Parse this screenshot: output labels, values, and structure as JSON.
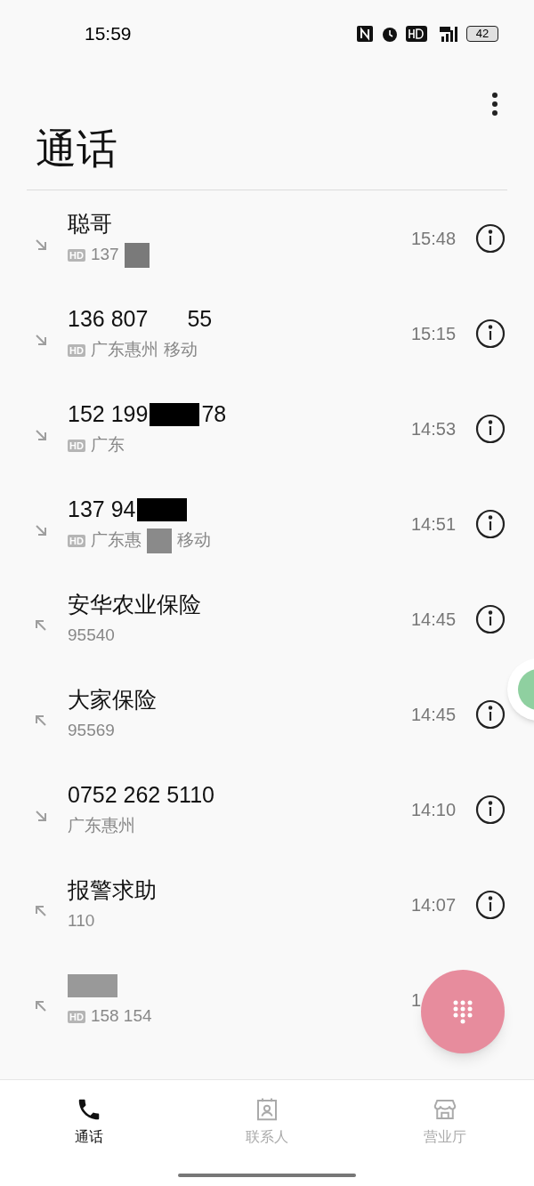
{
  "status_bar": {
    "time": "15:59",
    "battery": "42"
  },
  "header": {
    "title": "通话"
  },
  "calls": [
    {
      "kind": "incoming",
      "hd_badge": "HD",
      "title": [
        {
          "kind": "text",
          "text": "聪哥"
        }
      ],
      "subtitle": [
        {
          "kind": "text",
          "text": "137"
        },
        {
          "kind": "redacted",
          "color": "#7a7a7a"
        }
      ],
      "time": "15:48",
      "info_button": true
    },
    {
      "kind": "incoming",
      "hd_badge": "HD",
      "title": [
        {
          "kind": "text",
          "text": "136 807"
        },
        {
          "kind": "gap"
        },
        {
          "kind": "text",
          "text": "55"
        }
      ],
      "subtitle": [
        {
          "kind": "text",
          "text": "广东惠州"
        },
        {
          "kind": "text",
          "text": "移动"
        }
      ],
      "time": "15:15",
      "info_button": true
    },
    {
      "kind": "incoming",
      "hd_badge": "HD",
      "title": [
        {
          "kind": "text",
          "text": "152 199"
        },
        {
          "kind": "redacted",
          "color": "#000000"
        },
        {
          "kind": "text",
          "text": "78"
        }
      ],
      "subtitle": [
        {
          "kind": "text",
          "text": "广东"
        }
      ],
      "time": "14:53",
      "info_button": true
    },
    {
      "kind": "incoming",
      "hd_badge": "HD",
      "title": [
        {
          "kind": "text",
          "text": "137 94"
        },
        {
          "kind": "redacted",
          "color": "#000000"
        }
      ],
      "subtitle": [
        {
          "kind": "text",
          "text": "广东惠"
        },
        {
          "kind": "redacted",
          "color": "#8a8a8a"
        },
        {
          "kind": "text",
          "text": "移动"
        }
      ],
      "time": "14:51",
      "info_button": true
    },
    {
      "kind": "outgoing",
      "title": [
        {
          "kind": "text",
          "text": "安华农业保险"
        }
      ],
      "subtitle": [
        {
          "kind": "text",
          "text": "95540"
        }
      ],
      "time": "14:45",
      "info_button": true
    },
    {
      "kind": "outgoing",
      "title": [
        {
          "kind": "text",
          "text": "大家保险"
        }
      ],
      "subtitle": [
        {
          "kind": "text",
          "text": "95569"
        }
      ],
      "time": "14:45",
      "info_button": true
    },
    {
      "kind": "incoming",
      "title": [
        {
          "kind": "text",
          "text": "0752 262 5110"
        }
      ],
      "subtitle": [
        {
          "kind": "text",
          "text": "广东惠州"
        }
      ],
      "time": "14:10",
      "info_button": true
    },
    {
      "kind": "outgoing",
      "title": [
        {
          "kind": "text",
          "text": "报警求助"
        }
      ],
      "subtitle": [
        {
          "kind": "text",
          "text": "110"
        }
      ],
      "time": "14:07",
      "info_button": true
    },
    {
      "kind": "outgoing",
      "hd_badge": "HD",
      "title": [
        {
          "kind": "redacted",
          "color": "#999999"
        }
      ],
      "subtitle": [
        {
          "kind": "text",
          "text": "158 154"
        }
      ],
      "time": "1",
      "info_button": false
    }
  ],
  "tabs": [
    {
      "label": "通话",
      "kind": "phone",
      "selected": true
    },
    {
      "label": "联系人",
      "kind": "contacts",
      "selected": false
    },
    {
      "label": "营业厅",
      "kind": "store",
      "selected": false
    }
  ]
}
